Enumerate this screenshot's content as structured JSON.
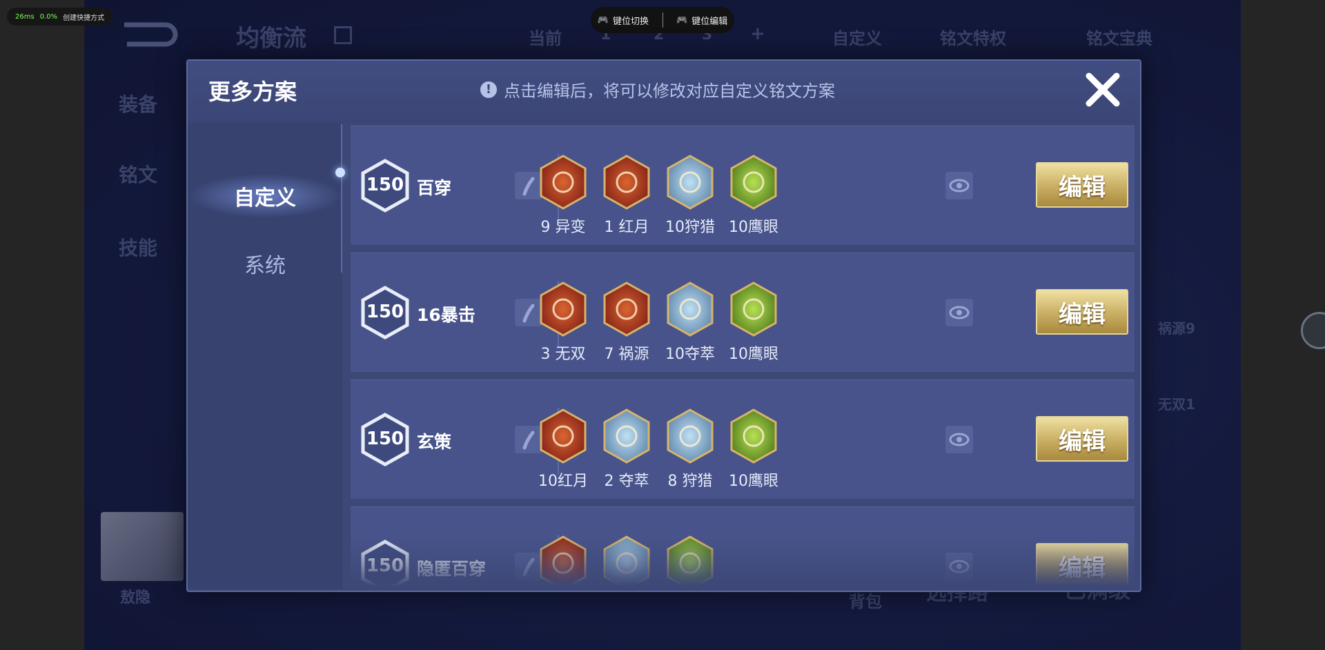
{
  "status_overlay": {
    "latency": "26ms",
    "cpu": "0.0%",
    "shortcut_label": "创建快捷方式"
  },
  "keymap_bar": {
    "switch_label": "键位切换",
    "edit_label": "键位编辑"
  },
  "background": {
    "title": "均衡流",
    "side_tabs": [
      "装备",
      "铭文",
      "技能"
    ],
    "page_label": "当前",
    "pages": [
      "1",
      "2",
      "3",
      "+"
    ],
    "custom_label": "自定义",
    "privilege_label": "铭文特权",
    "codex_label": "铭文宝典",
    "hero_name": "敖隐",
    "bag_label": "背包",
    "choose_label": "选择路",
    "maxed_label": "已满级",
    "right_runes": [
      "祸源9",
      "无双1"
    ]
  },
  "modal": {
    "title": "更多方案",
    "hint": "点击编辑后，将可以修改对应自定义铭文方案",
    "close_icon": "close-icon",
    "tabs": [
      {
        "label": "自定义",
        "active": true
      },
      {
        "label": "系统",
        "active": false
      }
    ],
    "edit_label": "编辑",
    "plans": [
      {
        "level": "150",
        "name": "百穿",
        "runes": [
          {
            "label": "9 异变",
            "color": "red",
            "icon": "rune-mutation-icon"
          },
          {
            "label": "1 红月",
            "color": "red",
            "icon": "rune-red-moon-icon"
          },
          {
            "label": "10狩猎",
            "color": "blue",
            "icon": "rune-hunt-icon"
          },
          {
            "label": "10鹰眼",
            "color": "green",
            "icon": "rune-hawkeye-icon"
          }
        ]
      },
      {
        "level": "150",
        "name": "16暴击",
        "runes": [
          {
            "label": "3 无双",
            "color": "red",
            "icon": "rune-peerless-icon"
          },
          {
            "label": "7 祸源",
            "color": "red",
            "icon": "rune-calamity-icon"
          },
          {
            "label": "10夺萃",
            "color": "blue",
            "icon": "rune-plunder-icon"
          },
          {
            "label": "10鹰眼",
            "color": "green",
            "icon": "rune-hawkeye-icon"
          }
        ]
      },
      {
        "level": "150",
        "name": "玄策",
        "runes": [
          {
            "label": "10红月",
            "color": "red",
            "icon": "rune-red-moon-icon"
          },
          {
            "label": "2 夺萃",
            "color": "blue",
            "icon": "rune-plunder-icon"
          },
          {
            "label": "8 狩猎",
            "color": "blue",
            "icon": "rune-hunt-icon"
          },
          {
            "label": "10鹰眼",
            "color": "green",
            "icon": "rune-hawkeye-icon"
          }
        ]
      },
      {
        "level": "150",
        "name": "隐匿百穿",
        "runes": [
          {
            "label": "",
            "color": "red",
            "icon": "rune-mutation-icon"
          },
          {
            "label": "",
            "color": "blue",
            "icon": "rune-flame-icon"
          },
          {
            "label": "",
            "color": "green",
            "icon": "rune-hawkeye-icon"
          }
        ]
      }
    ]
  },
  "colors": {
    "red": "#c0432a",
    "blue": "#8fb7d8",
    "green": "#8fbf3a",
    "gold": "#c8ad62"
  }
}
